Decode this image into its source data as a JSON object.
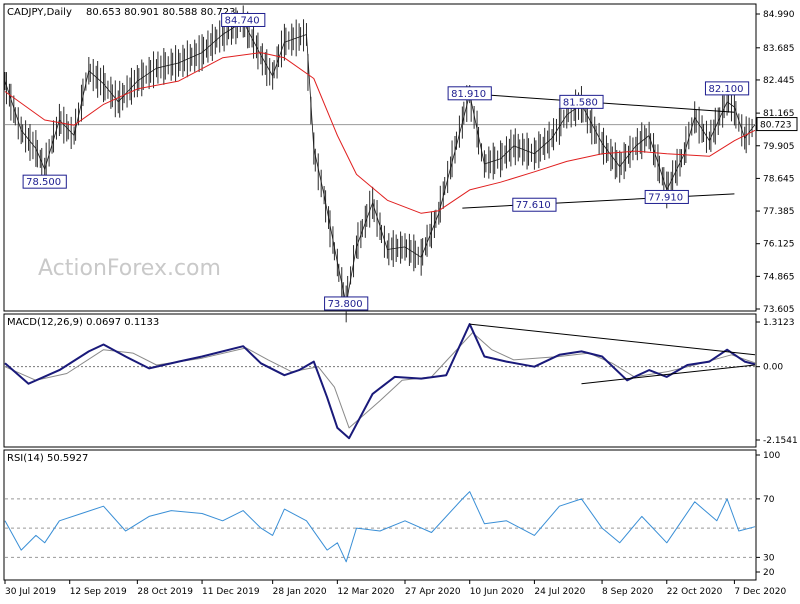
{
  "chart_data": [
    {
      "type": "line",
      "title": "CADJPY,Daily",
      "ohlc_header": "80.653 80.901 80.588 80.723",
      "ylim": [
        73.605,
        84.99
      ],
      "y_ticks": [
        84.99,
        83.685,
        82.445,
        81.165,
        79.905,
        78.645,
        77.385,
        76.125,
        74.865,
        73.605
      ],
      "y_tick_labels": [
        "84.990",
        "83.685",
        "82.445",
        "81.165",
        "79.905",
        "78.645",
        "77.385",
        "76.125",
        "74.865",
        "73.605"
      ],
      "current_price": "80.723",
      "x_ticks": [
        "30 Jul 2019",
        "12 Sep 2019",
        "28 Oct 2019",
        "11 Dec 2019",
        "28 Jan 2020",
        "12 Mar 2020",
        "27 Apr 2020",
        "10 Jun 2020",
        "24 Jul 2020",
        "8 Sep 2020",
        "22 Oct 2020",
        "7 Dec 2020"
      ],
      "watermark": "ActionForex.com",
      "series": [
        {
          "role": "close",
          "x": [
            "2019-07-30",
            "2019-08-10",
            "2019-08-20",
            "2019-08-26",
            "2019-09-05",
            "2019-09-15",
            "2019-09-25",
            "2019-10-05",
            "2019-10-15",
            "2019-10-28",
            "2019-11-10",
            "2019-11-25",
            "2019-12-11",
            "2019-12-25",
            "2020-01-08",
            "2020-01-20",
            "2020-01-28",
            "2020-02-05",
            "2020-02-20",
            "2020-02-25",
            "2020-03-03",
            "2020-03-12",
            "2020-03-18",
            "2020-03-25",
            "2020-04-05",
            "2020-04-15",
            "2020-04-27",
            "2020-05-08",
            "2020-05-20",
            "2020-06-05",
            "2020-06-10",
            "2020-06-20",
            "2020-07-01",
            "2020-07-10",
            "2020-07-24",
            "2020-08-05",
            "2020-08-15",
            "2020-08-25",
            "2020-09-08",
            "2020-09-20",
            "2020-10-01",
            "2020-10-10",
            "2020-10-22",
            "2020-11-03",
            "2020-11-10",
            "2020-11-20",
            "2020-12-02",
            "2020-12-07",
            "2020-12-14",
            "2020-12-21"
          ],
          "values": [
            82.4,
            80.5,
            79.8,
            79.0,
            80.9,
            80.3,
            82.8,
            82.3,
            81.6,
            82.4,
            82.9,
            83.1,
            83.5,
            84.2,
            84.7,
            83.4,
            82.6,
            83.9,
            84.2,
            79.8,
            78.0,
            75.4,
            73.8,
            76.0,
            77.7,
            75.9,
            76.0,
            75.6,
            77.3,
            80.8,
            81.9,
            79.2,
            79.4,
            79.9,
            79.6,
            80.2,
            81.1,
            81.5,
            80.0,
            79.1,
            79.9,
            80.3,
            78.2,
            79.6,
            81.0,
            80.1,
            81.6,
            81.4,
            80.2,
            80.72
          ]
        },
        {
          "role": "sma",
          "x": [
            "2019-07-30",
            "2019-08-26",
            "2019-09-15",
            "2019-10-05",
            "2019-10-28",
            "2019-11-25",
            "2019-12-25",
            "2020-01-20",
            "2020-02-05",
            "2020-02-25",
            "2020-03-12",
            "2020-03-25",
            "2020-04-15",
            "2020-05-08",
            "2020-05-20",
            "2020-06-10",
            "2020-07-01",
            "2020-07-24",
            "2020-08-15",
            "2020-09-08",
            "2020-10-01",
            "2020-10-22",
            "2020-11-20",
            "2020-12-07",
            "2020-12-21"
          ],
          "values": [
            82.0,
            80.9,
            80.7,
            81.5,
            82.1,
            82.4,
            83.3,
            83.5,
            83.3,
            82.5,
            80.3,
            78.8,
            77.8,
            77.3,
            77.4,
            78.2,
            78.5,
            78.9,
            79.3,
            79.6,
            79.7,
            79.6,
            79.5,
            80.1,
            80.5
          ]
        }
      ],
      "annotations": [
        {
          "label": "84.740",
          "x": "2020-01-08",
          "y": 84.74
        },
        {
          "label": "81.910",
          "x": "2020-06-10",
          "y": 81.91
        },
        {
          "label": "81.580",
          "x": "2020-08-25",
          "y": 81.58
        },
        {
          "label": "82.100",
          "x": "2020-12-02",
          "y": 82.1
        },
        {
          "label": "78.500",
          "x": "2019-08-26",
          "y": 78.5
        },
        {
          "label": "73.800",
          "x": "2020-03-18",
          "y": 73.8
        },
        {
          "label": "77.610",
          "x": "2020-07-24",
          "y": 77.61
        },
        {
          "label": "77.910",
          "x": "2020-10-22",
          "y": 77.91
        }
      ],
      "trendlines": [
        {
          "x": [
            "2020-06-10",
            "2020-12-07"
          ],
          "y": [
            81.91,
            81.2
          ]
        },
        {
          "x": [
            "2020-06-05",
            "2020-12-07"
          ],
          "y": [
            77.5,
            78.05
          ]
        }
      ]
    },
    {
      "type": "line",
      "title": "MACD(12,26,9) 0.0697 0.1133",
      "ylim": [
        -2.1541,
        1.3123
      ],
      "y_ticks": [
        1.3123,
        0.0,
        -2.1541
      ],
      "y_tick_labels": [
        "1.3123",
        "0.00",
        "-2.1541"
      ],
      "series": [
        {
          "role": "macd",
          "x": [
            "2019-07-30",
            "2019-08-15",
            "2019-09-05",
            "2019-09-25",
            "2019-10-05",
            "2019-10-20",
            "2019-11-05",
            "2019-11-25",
            "2019-12-11",
            "2020-01-08",
            "2020-01-20",
            "2020-02-05",
            "2020-02-15",
            "2020-02-25",
            "2020-03-05",
            "2020-03-12",
            "2020-03-20",
            "2020-04-05",
            "2020-04-20",
            "2020-05-08",
            "2020-05-25",
            "2020-06-10",
            "2020-06-20",
            "2020-07-05",
            "2020-07-24",
            "2020-08-10",
            "2020-08-25",
            "2020-09-08",
            "2020-09-25",
            "2020-10-10",
            "2020-10-22",
            "2020-11-05",
            "2020-11-20",
            "2020-12-02",
            "2020-12-14",
            "2020-12-21"
          ],
          "values": [
            0.1,
            -0.5,
            -0.1,
            0.45,
            0.65,
            0.3,
            -0.05,
            0.15,
            0.3,
            0.6,
            0.1,
            -0.25,
            -0.1,
            0.15,
            -0.9,
            -1.8,
            -2.1,
            -0.8,
            -0.3,
            -0.35,
            -0.25,
            1.25,
            0.3,
            0.15,
            0.0,
            0.35,
            0.45,
            0.3,
            -0.4,
            -0.1,
            -0.3,
            0.05,
            0.15,
            0.5,
            0.15,
            0.07
          ]
        },
        {
          "role": "signal",
          "x": [
            "2019-07-30",
            "2019-08-20",
            "2019-09-10",
            "2019-10-05",
            "2019-10-25",
            "2019-11-10",
            "2019-12-11",
            "2020-01-10",
            "2020-01-25",
            "2020-02-10",
            "2020-02-28",
            "2020-03-10",
            "2020-03-20",
            "2020-04-10",
            "2020-04-25",
            "2020-05-15",
            "2020-06-12",
            "2020-06-25",
            "2020-07-10",
            "2020-08-10",
            "2020-08-30",
            "2020-09-15",
            "2020-09-30",
            "2020-10-22",
            "2020-11-10",
            "2020-12-05",
            "2020-12-21"
          ],
          "values": [
            0.0,
            -0.4,
            -0.2,
            0.5,
            0.4,
            0.05,
            0.25,
            0.55,
            0.2,
            -0.15,
            0.0,
            -0.6,
            -1.8,
            -1.0,
            -0.4,
            -0.3,
            1.0,
            0.5,
            0.2,
            0.3,
            0.4,
            0.1,
            -0.3,
            -0.15,
            0.05,
            0.35,
            0.11
          ]
        }
      ],
      "trendlines": [
        {
          "x": [
            "2020-06-10",
            "2020-12-21"
          ],
          "y": [
            1.25,
            0.35
          ]
        },
        {
          "x": [
            "2020-08-25",
            "2020-12-21"
          ],
          "y": [
            -0.5,
            0.05
          ]
        }
      ]
    },
    {
      "type": "line",
      "title": "RSI(14) 50.5927",
      "ylim": [
        20,
        100
      ],
      "y_ticks": [
        100,
        70,
        30,
        20
      ],
      "y_tick_labels": [
        "100",
        "70",
        "30",
        "20"
      ],
      "hlines": [
        70,
        50,
        30
      ],
      "series": [
        {
          "role": "rsi",
          "x": [
            "2019-07-30",
            "2019-08-10",
            "2019-08-20",
            "2019-08-26",
            "2019-09-05",
            "2019-09-20",
            "2019-10-05",
            "2019-10-20",
            "2019-11-05",
            "2019-11-20",
            "2019-12-11",
            "2019-12-25",
            "2020-01-08",
            "2020-01-20",
            "2020-01-28",
            "2020-02-05",
            "2020-02-20",
            "2020-03-05",
            "2020-03-12",
            "2020-03-18",
            "2020-03-25",
            "2020-04-10",
            "2020-04-27",
            "2020-05-15",
            "2020-06-05",
            "2020-06-10",
            "2020-06-20",
            "2020-07-05",
            "2020-07-24",
            "2020-08-10",
            "2020-08-25",
            "2020-09-08",
            "2020-09-20",
            "2020-10-05",
            "2020-10-22",
            "2020-11-10",
            "2020-11-25",
            "2020-12-02",
            "2020-12-10",
            "2020-12-21"
          ],
          "values": [
            55,
            35,
            45,
            40,
            55,
            60,
            65,
            48,
            58,
            62,
            60,
            55,
            62,
            50,
            45,
            63,
            55,
            35,
            40,
            27,
            50,
            48,
            55,
            47,
            70,
            75,
            53,
            55,
            45,
            65,
            70,
            50,
            40,
            58,
            40,
            68,
            55,
            70,
            48,
            51
          ]
        }
      ]
    }
  ]
}
